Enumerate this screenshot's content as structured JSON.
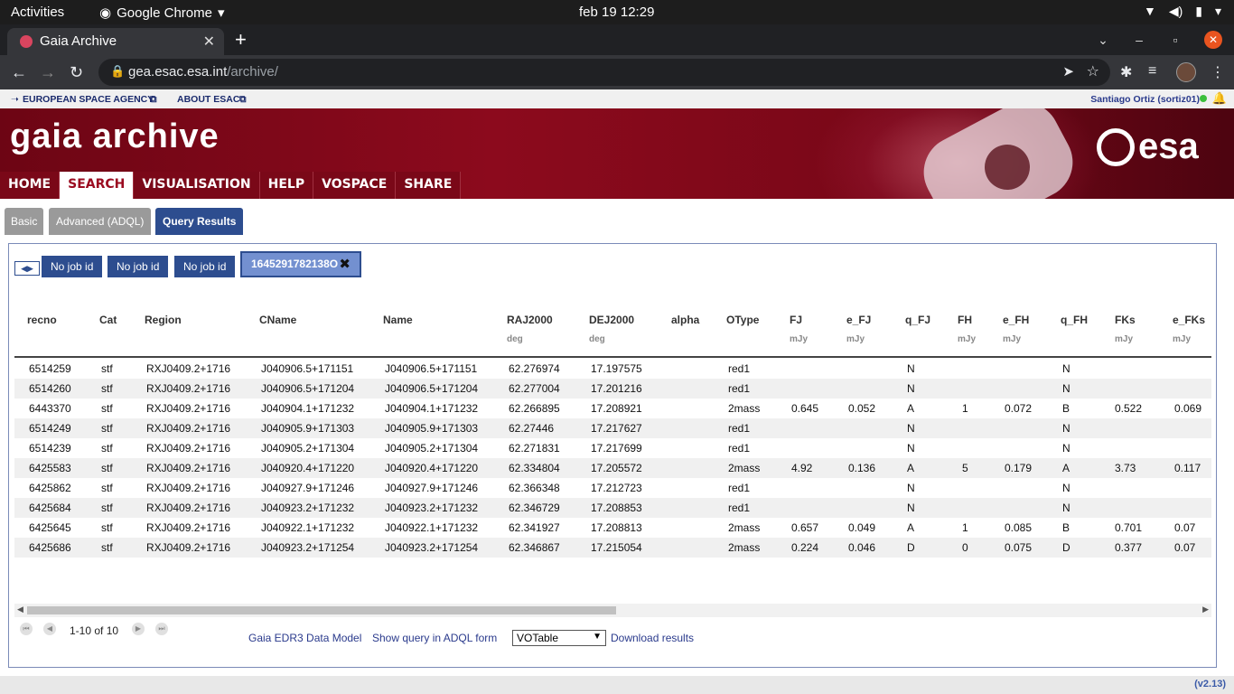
{
  "os": {
    "activities": "Activities",
    "app": "Google Chrome",
    "clock": "feb 19  12:29"
  },
  "browser": {
    "tab_title": "Gaia Archive",
    "url_host": "gea.esac.esa.int",
    "url_path": "/archive/"
  },
  "esa_nav": {
    "esa_link": "EUROPEAN SPACE AGENCY",
    "esac_link": "ABOUT ESAC",
    "user": "Santiago Ortiz (sortiz01)"
  },
  "banner": {
    "title": "gaia archive",
    "logo_text": "esa",
    "menu": [
      "HOME",
      "SEARCH",
      "VISUALISATION",
      "HELP",
      "VOSPACE",
      "SHARE"
    ]
  },
  "page_tabs": {
    "basic": "Basic",
    "advanced": "Advanced (ADQL)",
    "results": "Query Results"
  },
  "jobs": {
    "tabs": [
      "No job id",
      "No job id",
      "No job id"
    ],
    "active": "1645291782138O"
  },
  "table": {
    "columns": [
      {
        "name": "recno",
        "unit": ""
      },
      {
        "name": "Cat",
        "unit": ""
      },
      {
        "name": "Region",
        "unit": ""
      },
      {
        "name": "CName",
        "unit": ""
      },
      {
        "name": "Name",
        "unit": ""
      },
      {
        "name": "RAJ2000",
        "unit": "deg"
      },
      {
        "name": "DEJ2000",
        "unit": "deg"
      },
      {
        "name": "alpha",
        "unit": ""
      },
      {
        "name": "OType",
        "unit": ""
      },
      {
        "name": "FJ",
        "unit": "mJy"
      },
      {
        "name": "e_FJ",
        "unit": "mJy"
      },
      {
        "name": "q_FJ",
        "unit": ""
      },
      {
        "name": "FH",
        "unit": "mJy"
      },
      {
        "name": "e_FH",
        "unit": "mJy"
      },
      {
        "name": "q_FH",
        "unit": ""
      },
      {
        "name": "FKs",
        "unit": "mJy"
      },
      {
        "name": "e_FKs",
        "unit": "mJy"
      }
    ],
    "rows": [
      [
        "6514259",
        "stf",
        "RXJ0409.2+1716",
        "J040906.5+171151",
        "J040906.5+171151",
        "62.276974",
        "17.197575",
        "",
        "red1",
        "",
        "",
        "N",
        "",
        "",
        "N",
        "",
        ""
      ],
      [
        "6514260",
        "stf",
        "RXJ0409.2+1716",
        "J040906.5+171204",
        "J040906.5+171204",
        "62.277004",
        "17.201216",
        "",
        "red1",
        "",
        "",
        "N",
        "",
        "",
        "N",
        "",
        ""
      ],
      [
        "6443370",
        "stf",
        "RXJ0409.2+1716",
        "J040904.1+171232",
        "J040904.1+171232",
        "62.266895",
        "17.208921",
        "",
        "2mass",
        "0.645",
        "0.052",
        "A",
        "1",
        "0.072",
        "B",
        "0.522",
        "0.069"
      ],
      [
        "6514249",
        "stf",
        "RXJ0409.2+1716",
        "J040905.9+171303",
        "J040905.9+171303",
        "62.27446",
        "17.217627",
        "",
        "red1",
        "",
        "",
        "N",
        "",
        "",
        "N",
        "",
        ""
      ],
      [
        "6514239",
        "stf",
        "RXJ0409.2+1716",
        "J040905.2+171304",
        "J040905.2+171304",
        "62.271831",
        "17.217699",
        "",
        "red1",
        "",
        "",
        "N",
        "",
        "",
        "N",
        "",
        ""
      ],
      [
        "6425583",
        "stf",
        "RXJ0409.2+1716",
        "J040920.4+171220",
        "J040920.4+171220",
        "62.334804",
        "17.205572",
        "",
        "2mass",
        "4.92",
        "0.136",
        "A",
        "5",
        "0.179",
        "A",
        "3.73",
        "0.117"
      ],
      [
        "6425862",
        "stf",
        "RXJ0409.2+1716",
        "J040927.9+171246",
        "J040927.9+171246",
        "62.366348",
        "17.212723",
        "",
        "red1",
        "",
        "",
        "N",
        "",
        "",
        "N",
        "",
        ""
      ],
      [
        "6425684",
        "stf",
        "RXJ0409.2+1716",
        "J040923.2+171232",
        "J040923.2+171232",
        "62.346729",
        "17.208853",
        "",
        "red1",
        "",
        "",
        "N",
        "",
        "",
        "N",
        "",
        ""
      ],
      [
        "6425645",
        "stf",
        "RXJ0409.2+1716",
        "J040922.1+171232",
        "J040922.1+171232",
        "62.341927",
        "17.208813",
        "",
        "2mass",
        "0.657",
        "0.049",
        "A",
        "1",
        "0.085",
        "B",
        "0.701",
        "0.07"
      ],
      [
        "6425686",
        "stf",
        "RXJ0409.2+1716",
        "J040923.2+171254",
        "J040923.2+171254",
        "62.346867",
        "17.215054",
        "",
        "2mass",
        "0.224",
        "0.046",
        "D",
        "0",
        "0.075",
        "D",
        "0.377",
        "0.07"
      ]
    ]
  },
  "pager": {
    "range": "1-10 of 10"
  },
  "footer_links": {
    "data_model": "Gaia EDR3 Data Model",
    "show_query": "Show query in ADQL form",
    "format": "VOTable",
    "download": "Download results"
  },
  "version": "(v2.13)"
}
